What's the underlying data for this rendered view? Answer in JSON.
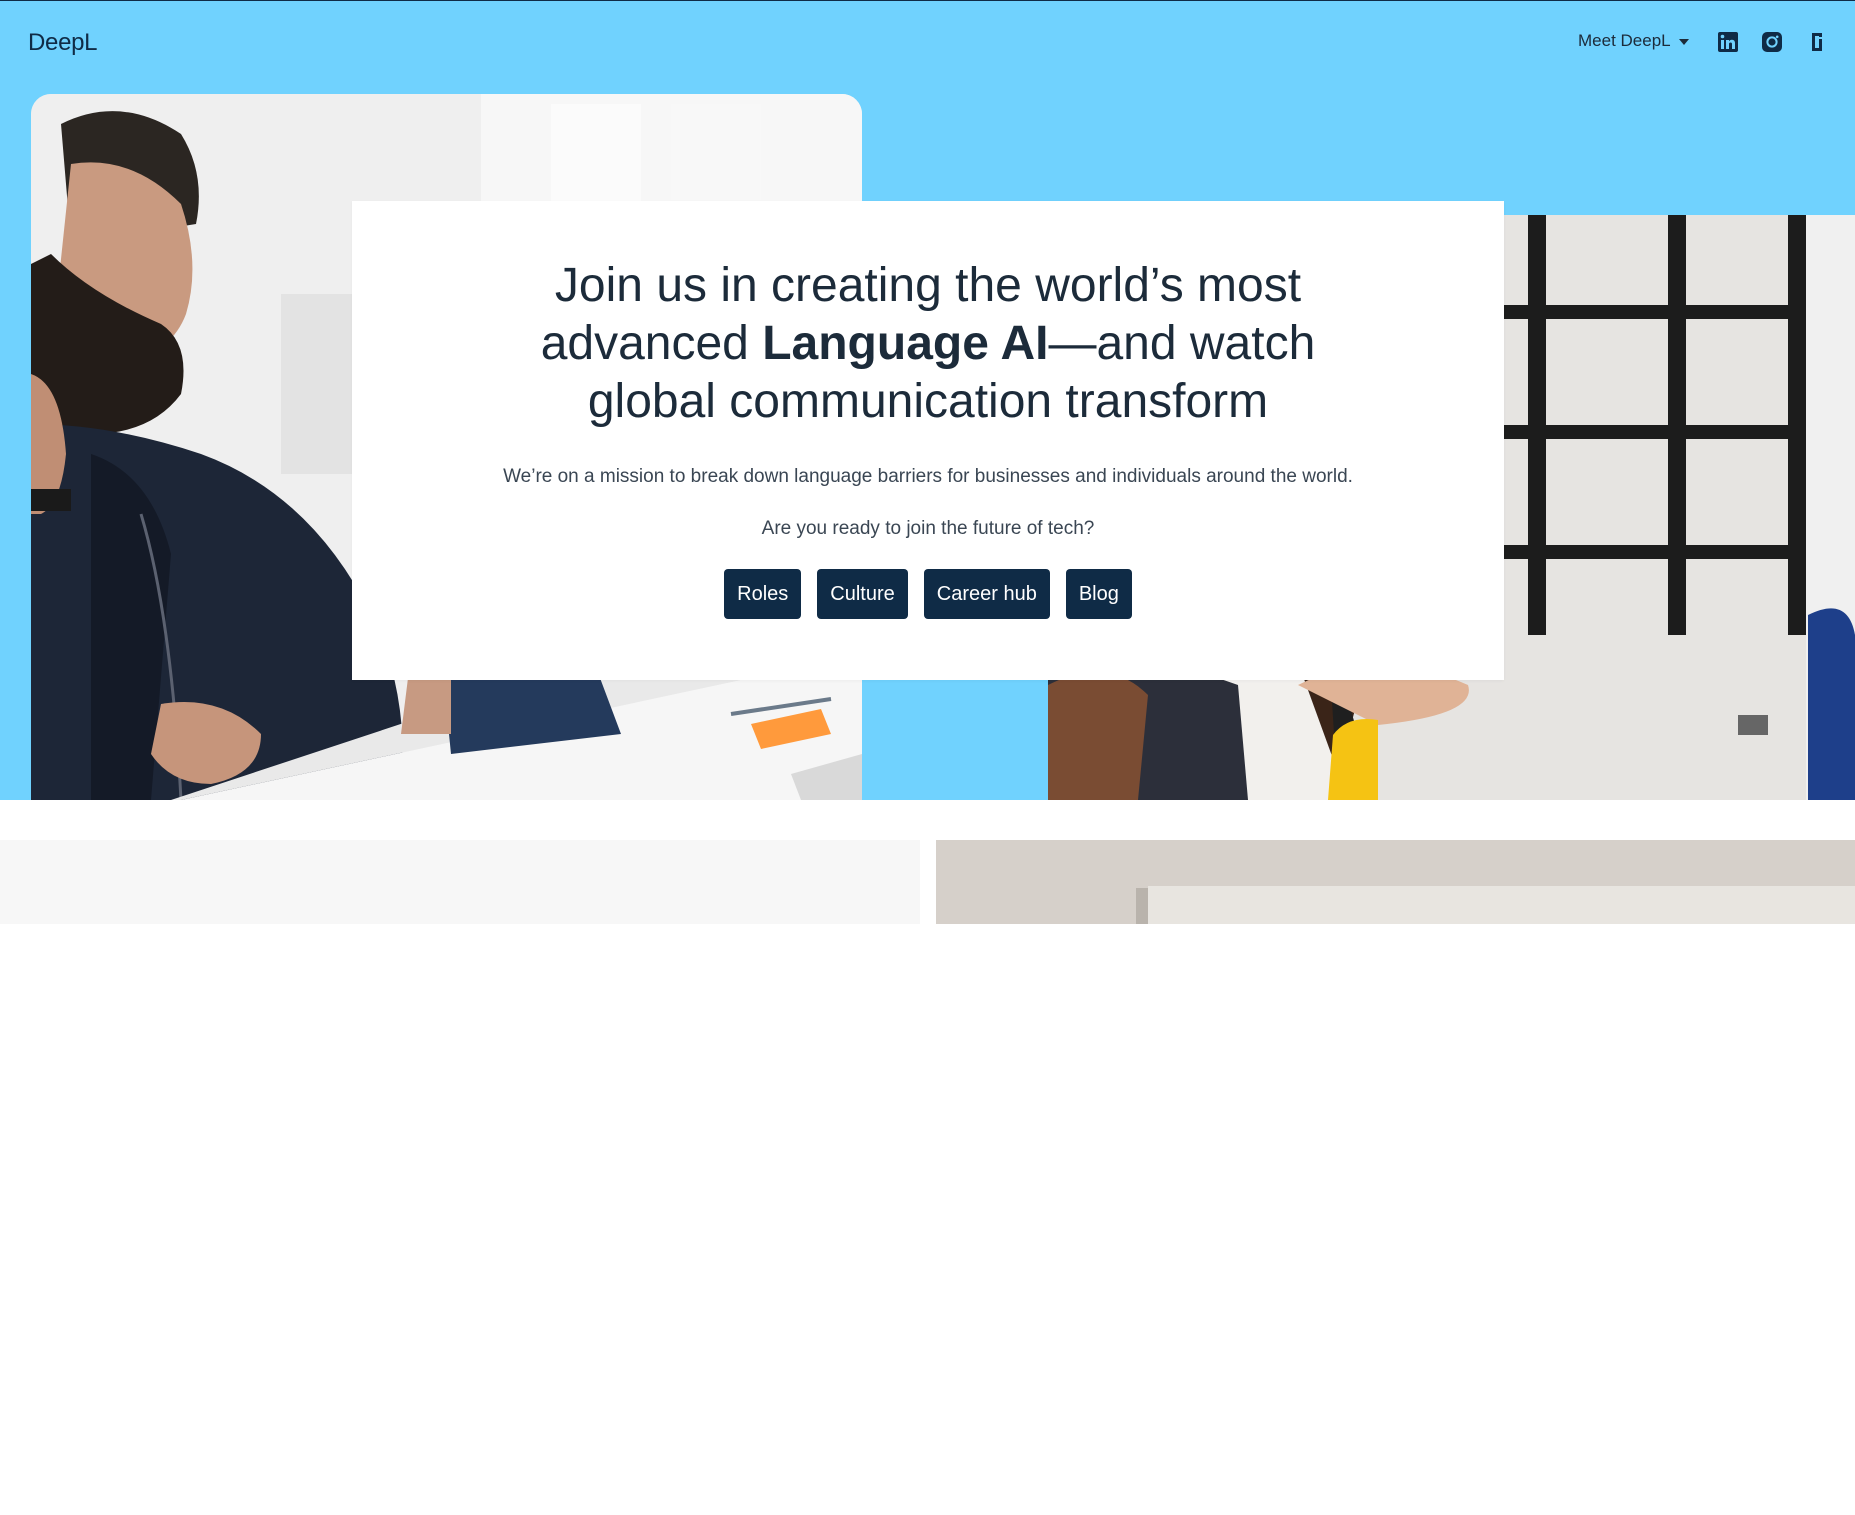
{
  "nav": {
    "logo": "DeepL",
    "meet_label": "Meet DeepL",
    "social_icons": [
      "linkedin-icon",
      "instagram-icon",
      "glassdoor-icon"
    ]
  },
  "hero": {
    "headline_pre": "Join us in creating the world’s most advanced ",
    "headline_bold": "Language AI",
    "headline_post": "—and watch global communication transform",
    "mission": "We’re on a mission to break down language barriers for businesses and individuals around the world.",
    "question": "Are you ready to join the future of tech?",
    "buttons": [
      "Roles",
      "Culture",
      "Career hub",
      "Blog"
    ]
  },
  "colors": {
    "hero_bg": "#70d2fe",
    "button_bg": "#0f2b46",
    "text_dark": "#1c2b3a"
  }
}
